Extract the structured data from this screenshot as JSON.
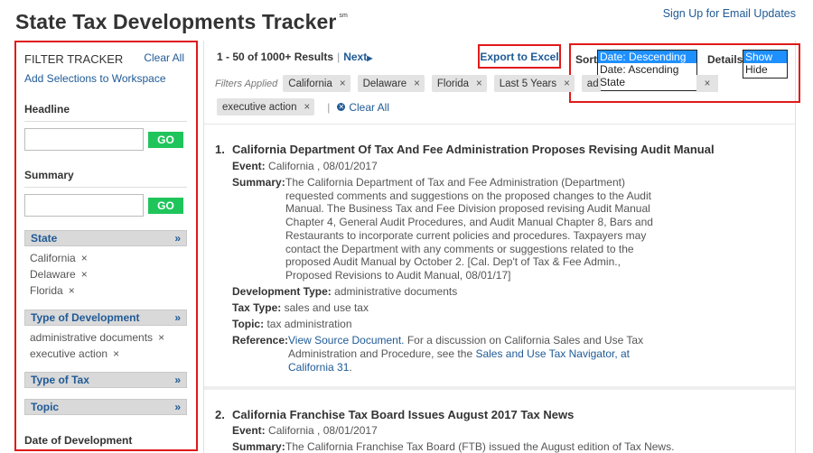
{
  "header": {
    "title": "State Tax Developments Tracker",
    "title_mark": "sm",
    "signup_link": "Sign Up for Email Updates"
  },
  "sidebar": {
    "title": "FILTER TRACKER",
    "clear_all": "Clear All",
    "add_selections": "Add Selections to Workspace",
    "headline_label": "Headline",
    "headline_go": "GO",
    "summary_label": "Summary",
    "summary_go": "GO",
    "facets": [
      {
        "label": "State",
        "values": [
          "California",
          "Delaware",
          "Florida"
        ]
      },
      {
        "label": "Type of Development",
        "values": [
          "administrative documents",
          "executive action"
        ]
      },
      {
        "label": "Type of Tax",
        "values": []
      },
      {
        "label": "Topic",
        "values": []
      }
    ],
    "facet_chevron": "»",
    "remove_glyph": "×",
    "date_label": "Date of Development"
  },
  "toolbar": {
    "results_count": "1 - 50 of 1000+ Results",
    "separator": "|",
    "next_label": "Next",
    "export_label": "Export to Excel",
    "sort_label": "Sort",
    "sort_options": [
      "Date: Descending",
      "Date: Ascending",
      "State"
    ],
    "sort_selected": "Date: Descending",
    "details_label": "Details",
    "details_options": [
      "Show",
      "Hide"
    ],
    "details_selected": "Show"
  },
  "filters_applied": {
    "label": "Filters Applied",
    "chips": [
      "California",
      "Delaware",
      "Florida",
      "Last 5 Years",
      "ad"
    ],
    "chips_row2": [
      "executive action"
    ],
    "clear_all": "Clear All"
  },
  "results": [
    {
      "number": "1.",
      "title": "California Department Of Tax And Fee Administration Proposes Revising Audit Manual",
      "event_label": "Event:",
      "event_value": "California , 08/01/2017",
      "summary_label": "Summary:",
      "summary": "The California Department of Tax and Fee Administration (Department) requested comments and suggestions on the proposed changes to the Audit Manual. The Business Tax and Fee Division proposed revising Audit Manual Chapter 4, General Audit Procedures, and Audit Manual Chapter 8, Bars and Restaurants to incorporate current policies and procedures. Taxpayers may contact the Department with any comments or suggestions related to the proposed Audit Manual by October 2. [Cal. Dep't of Tax & Fee Admin., Proposed Revisions to Audit Manual, 08/01/17]",
      "dev_type_label": "Development Type:",
      "dev_type_value": "administrative documents",
      "tax_type_label": "Tax Type:",
      "tax_type_value": "sales and use tax",
      "topic_label": "Topic:",
      "topic_value": "tax administration",
      "reference_label": "Reference:",
      "reference_link1": "View Source Document.",
      "reference_text": " For a discussion on California Sales and Use Tax Administration and Procedure, see the ",
      "reference_link2": "Sales and Use Tax Navigator, at California 31",
      "reference_end": "."
    },
    {
      "number": "2.",
      "title": "California Franchise Tax Board Issues August 2017 Tax News",
      "event_label": "Event:",
      "event_value": "California , 08/01/2017",
      "summary_label": "Summary:",
      "summary": "The California Franchise Tax Board (FTB) issued the August edition of Tax News."
    }
  ],
  "colors": {
    "link": "#1f5a96",
    "highlight_border": "#e01a1a",
    "go_button": "#1fc55b",
    "select_highlight": "#1e90ff"
  }
}
